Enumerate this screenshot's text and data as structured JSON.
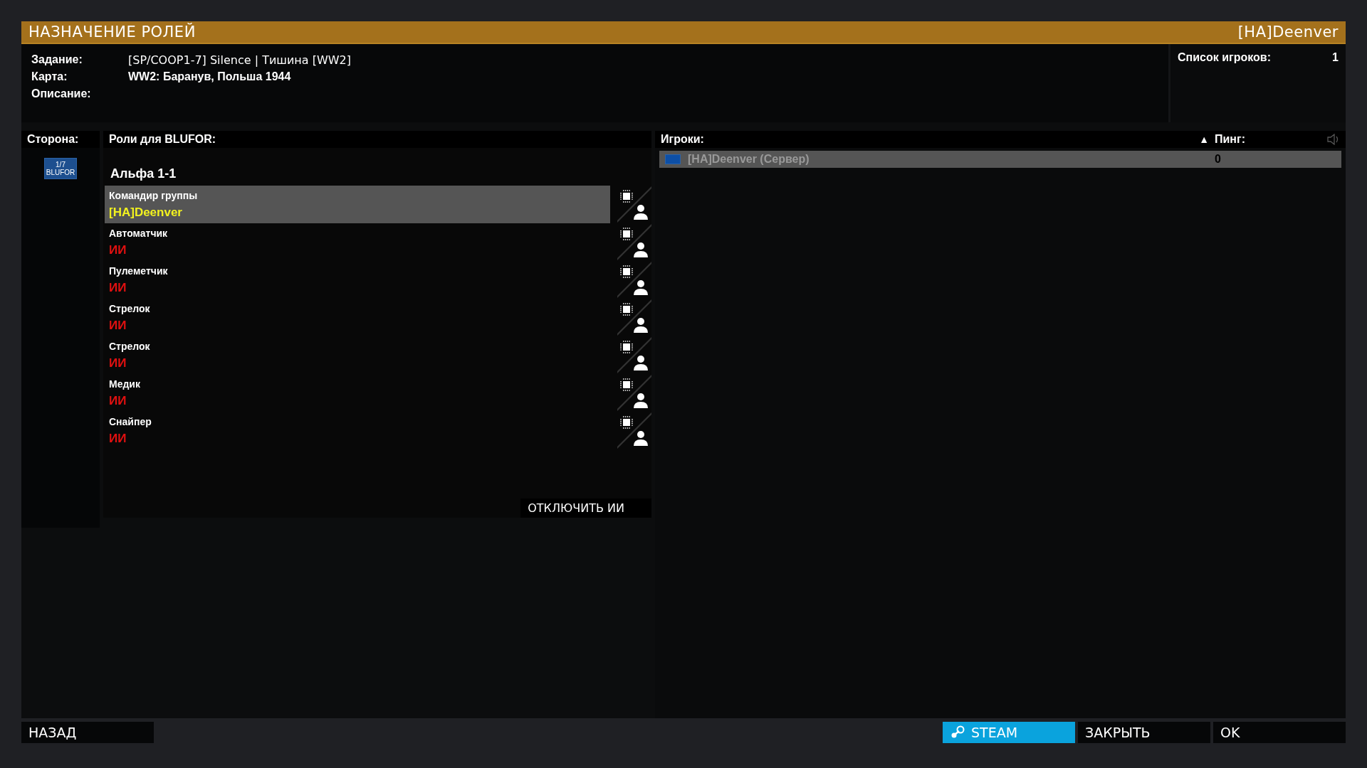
{
  "window": {
    "title": "НАЗНАЧЕНИЕ РОЛЕЙ",
    "user": "[HA]Deenver"
  },
  "mission": {
    "fields": [
      {
        "label": "Задание:",
        "value": "[SP/COOP1-7] Silence | Тишина [WW2]",
        "kind": "light"
      },
      {
        "label": "Карта:",
        "value": "WW2: Баранув, Польша 1944",
        "kind": "bold"
      },
      {
        "label": "Описание:"
      }
    ],
    "player_list_label": "Список игроков:",
    "player_count": "1"
  },
  "sides": {
    "heading": "Сторона:",
    "items": [
      {
        "count": "1/7",
        "name": "BLUFOR",
        "selected": true
      }
    ]
  },
  "roles": {
    "heading": "Роли для BLUFOR:",
    "group": "Альфа 1-1",
    "items": [
      {
        "role": "Командир группы",
        "occupant": "[HA]Deenver",
        "kind": "player",
        "selected": true
      },
      {
        "role": "Автоматчик",
        "occupant": "ИИ",
        "kind": "ai",
        "selected": false
      },
      {
        "role": "Пулеметчик",
        "occupant": "ИИ",
        "kind": "ai",
        "selected": false
      },
      {
        "role": "Стрелок",
        "occupant": "ИИ",
        "kind": "ai",
        "selected": false
      },
      {
        "role": "Стрелок",
        "occupant": "ИИ",
        "kind": "ai",
        "selected": false
      },
      {
        "role": "Медик",
        "occupant": "ИИ",
        "kind": "ai",
        "selected": false
      },
      {
        "role": "Снайпер",
        "occupant": "ИИ",
        "kind": "ai",
        "selected": false
      }
    ],
    "disable_ai_button": "ОТКЛЮЧИТЬ ИИ"
  },
  "players": {
    "heading": "Игроки:",
    "sort_arrow": "▲",
    "ping_heading": "Пинг:",
    "rows": [
      {
        "name": "[HA]Deenver (Сервер)",
        "ping": "0",
        "selected": true
      }
    ]
  },
  "buttons": [
    {
      "label": "НАЗАД",
      "kind": "plain"
    },
    {
      "label": "STEAM",
      "kind": "steam"
    },
    {
      "label": "ЗАКРЫТЬ",
      "kind": "plain"
    },
    {
      "label": "OK",
      "kind": "plain"
    }
  ]
}
